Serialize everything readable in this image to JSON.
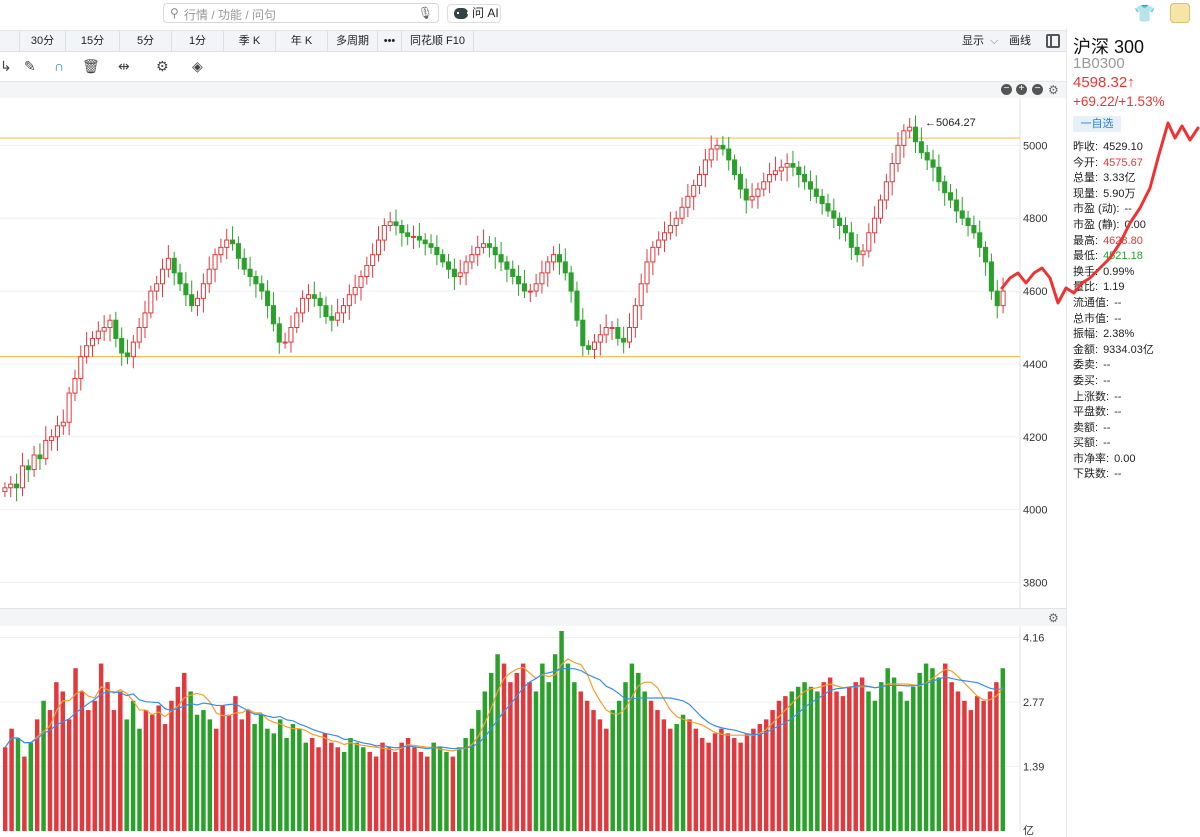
{
  "search": {
    "placeholder": "行情 / 功能 / 问句"
  },
  "ai_button": {
    "label": "问 AI"
  },
  "periods": [
    "30分",
    "15分",
    "5分",
    "1分",
    "季 K",
    "年 K",
    "多周期",
    "•••",
    "同花顺 F10"
  ],
  "period_right": {
    "display": "显示",
    "draw": "画线"
  },
  "stock": {
    "name": "沪深 300",
    "code": "1B0300",
    "price": "4598.32↑",
    "change": "+69.22/+1.53%",
    "fav": "一自选"
  },
  "stats": [
    {
      "k": "昨收:",
      "v": "4529.10",
      "c": ""
    },
    {
      "k": "今开:",
      "v": "4575.67",
      "c": "red"
    },
    {
      "k": "总量:",
      "v": "3.33亿",
      "c": ""
    },
    {
      "k": "现量:",
      "v": "5.90万",
      "c": ""
    },
    {
      "k": "市盈 (动):",
      "v": "--",
      "c": ""
    },
    {
      "k": "市盈 (静):",
      "v": "0.00",
      "c": ""
    },
    {
      "k": "最高:",
      "v": "4628.80",
      "c": "red"
    },
    {
      "k": "最低:",
      "v": "4521.18",
      "c": "green"
    },
    {
      "k": "换手:",
      "v": "0.99%",
      "c": ""
    },
    {
      "k": "量比:",
      "v": "1.19",
      "c": ""
    },
    {
      "k": "流通值:",
      "v": "--",
      "c": ""
    },
    {
      "k": "总市值:",
      "v": "--",
      "c": ""
    },
    {
      "k": "振幅:",
      "v": "2.38%",
      "c": ""
    },
    {
      "k": "金额:",
      "v": "9334.03亿",
      "c": ""
    },
    {
      "k": "委卖:",
      "v": "--",
      "c": ""
    },
    {
      "k": "委买:",
      "v": "--",
      "c": ""
    },
    {
      "k": "上涨数:",
      "v": "--",
      "c": ""
    },
    {
      "k": "平盘数:",
      "v": "--",
      "c": ""
    },
    {
      "k": "卖额:",
      "v": "--",
      "c": ""
    },
    {
      "k": "买额:",
      "v": "--",
      "c": ""
    },
    {
      "k": "市净率:",
      "v": "0.00",
      "c": ""
    },
    {
      "k": "下跌数:",
      "v": "--",
      "c": ""
    }
  ],
  "colors": {
    "up": "#e0393e",
    "down": "#2aa12a",
    "ma5": "#f0a030",
    "ma10": "#3b8ee8",
    "hline": "#f5c05a"
  },
  "chart_data": [
    {
      "type": "candlestick",
      "ylim": [
        3730,
        5130
      ],
      "yticks": [
        3800,
        4000,
        4200,
        4400,
        4600,
        4800,
        5000
      ],
      "resistance": 5020,
      "support": 4420,
      "max_label": "←5064.27",
      "max_value": 5064.27,
      "path": [
        4060,
        4070,
        4060,
        4120,
        4110,
        4150,
        4140,
        4190,
        4200,
        4230,
        4240,
        4320,
        4360,
        4420,
        4450,
        4470,
        4490,
        4500,
        4520,
        4470,
        4430,
        4420,
        4460,
        4500,
        4540,
        4600,
        4620,
        4660,
        4690,
        4650,
        4620,
        4590,
        4560,
        4580,
        4620,
        4660,
        4700,
        4720,
        4740,
        4730,
        4690,
        4660,
        4640,
        4620,
        4600,
        4560,
        4510,
        4460,
        4460,
        4500,
        4540,
        4580,
        4590,
        4580,
        4560,
        4530,
        4520,
        4540,
        4560,
        4590,
        4610,
        4640,
        4670,
        4700,
        4740,
        4780,
        4790,
        4780,
        4760,
        4750,
        4750,
        4740,
        4730,
        4720,
        4700,
        4680,
        4660,
        4640,
        4650,
        4680,
        4700,
        4720,
        4730,
        4720,
        4700,
        4680,
        4660,
        4640,
        4620,
        4600,
        4600,
        4620,
        4650,
        4680,
        4700,
        4680,
        4650,
        4600,
        4520,
        4450,
        4440,
        4460,
        4480,
        4500,
        4500,
        4470,
        4460,
        4500,
        4560,
        4620,
        4680,
        4720,
        4740,
        4760,
        4780,
        4800,
        4830,
        4860,
        4890,
        4920,
        4960,
        4990,
        5000,
        4990,
        4960,
        4920,
        4880,
        4850,
        4860,
        4880,
        4900,
        4920,
        4930,
        4940,
        4950,
        4940,
        4920,
        4900,
        4880,
        4860,
        4840,
        4820,
        4800,
        4780,
        4760,
        4720,
        4700,
        4710,
        4760,
        4800,
        4850,
        4900,
        4950,
        5000,
        5040,
        5050,
        5010,
        4980,
        4960,
        4940,
        4900,
        4870,
        4850,
        4820,
        4800,
        4780,
        4760,
        4720,
        4680,
        4600,
        4560,
        4600
      ]
    },
    {
      "type": "bar",
      "ylim": [
        0,
        4.3
      ],
      "yticks": [
        1.39,
        2.77,
        4.16
      ],
      "unit": "亿",
      "vol": [
        1.8,
        2.2,
        2.0,
        1.6,
        1.9,
        2.4,
        2.8,
        2.6,
        3.2,
        3.0,
        2.4,
        3.5,
        3.0,
        2.6,
        2.8,
        3.6,
        3.2,
        2.6,
        3.0,
        2.4,
        2.8,
        2.2,
        2.6,
        2.5,
        2.7,
        2.3,
        2.8,
        3.1,
        3.4,
        3.0,
        2.5,
        2.6,
        2.4,
        2.2,
        2.7,
        2.5,
        2.9,
        2.4,
        2.6,
        2.3,
        2.5,
        2.2,
        2.1,
        2.4,
        2.0,
        2.3,
        2.2,
        1.9,
        2.0,
        1.8,
        2.1,
        1.9,
        1.8,
        1.7,
        2.0,
        1.9,
        1.8,
        1.7,
        1.6,
        1.9,
        1.8,
        1.7,
        1.9,
        2.0,
        1.8,
        1.7,
        1.6,
        1.9,
        1.8,
        1.7,
        1.6,
        1.8,
        2.0,
        2.2,
        2.6,
        3.0,
        3.4,
        3.8,
        3.6,
        3.2,
        3.4,
        3.6,
        3.2,
        3.0,
        3.6,
        3.2,
        3.8,
        4.3,
        3.6,
        3.2,
        3.0,
        2.8,
        2.6,
        2.4,
        2.2,
        2.6,
        2.8,
        3.2,
        3.6,
        3.4,
        3.0,
        2.8,
        2.6,
        2.4,
        2.2,
        2.3,
        2.5,
        2.4,
        2.2,
        2.0,
        1.9,
        2.1,
        2.2,
        2.1,
        2.0,
        1.9,
        2.1,
        2.2,
        2.3,
        2.4,
        2.6,
        2.8,
        2.9,
        3.0,
        3.1,
        3.2,
        3.1,
        3.0,
        3.2,
        3.3,
        3.0,
        2.9,
        3.1,
        3.2,
        3.3,
        3.0,
        2.8,
        3.2,
        3.5,
        3.3,
        3.0,
        2.8,
        3.1,
        3.4,
        3.6,
        3.5,
        3.3,
        3.6,
        3.2,
        3.0,
        2.8,
        2.6,
        2.9,
        2.8,
        3.0,
        3.2,
        3.5
      ]
    }
  ]
}
